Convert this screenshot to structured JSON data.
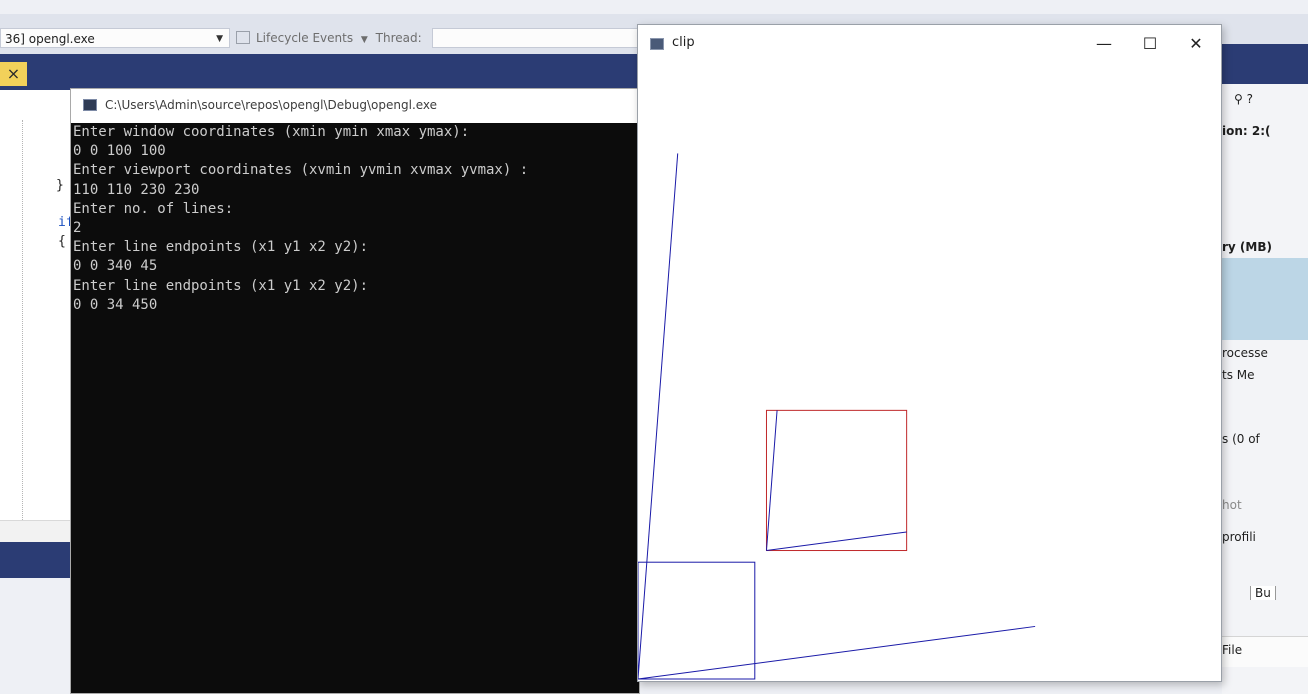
{
  "vs": {
    "process_combo": "36] opengl.exe",
    "lifecycle_label": "Lifecycle Events",
    "thread_label": "Thread:",
    "doc_close_glyph": "×",
    "code_fragments": [
      "}",
      "if",
      "{"
    ],
    "right_panel": {
      "items": [
        "ion: 2:(",
        "ry (MB)",
        "rocesse",
        "ts  Me",
        "s (0 of",
        "hot",
        "profili",
        "Bu",
        "File"
      ]
    }
  },
  "console": {
    "title": "C:\\Users\\Admin\\source\\repos\\opengl\\Debug\\opengl.exe",
    "lines": [
      "Enter window coordinates (xmin ymin xmax ymax):",
      "0 0 100 100",
      "Enter viewport coordinates (xvmin yvmin xvmax yvmax) :",
      "110 110 230 230",
      "Enter no. of lines:",
      "2",
      "Enter line endpoints (x1 y1 x2 y2):",
      "0 0 340 45",
      "Enter line endpoints (x1 y1 x2 y2):",
      "0 0 34 450"
    ]
  },
  "clip_window": {
    "title": "clip",
    "minimize_glyph": "—",
    "maximize_glyph": "☐",
    "close_glyph": "✕",
    "colors": {
      "window_rect": "#1a1aa8",
      "lines": "#1a1aa8",
      "viewport_rect": "#c0282a",
      "clipped": "#1a1aa8"
    },
    "world": {
      "window": [
        0,
        0,
        100,
        100
      ],
      "viewport": [
        110,
        110,
        230,
        230
      ],
      "lines": [
        [
          0,
          0,
          340,
          45
        ],
        [
          0,
          0,
          34,
          450
        ]
      ]
    }
  }
}
